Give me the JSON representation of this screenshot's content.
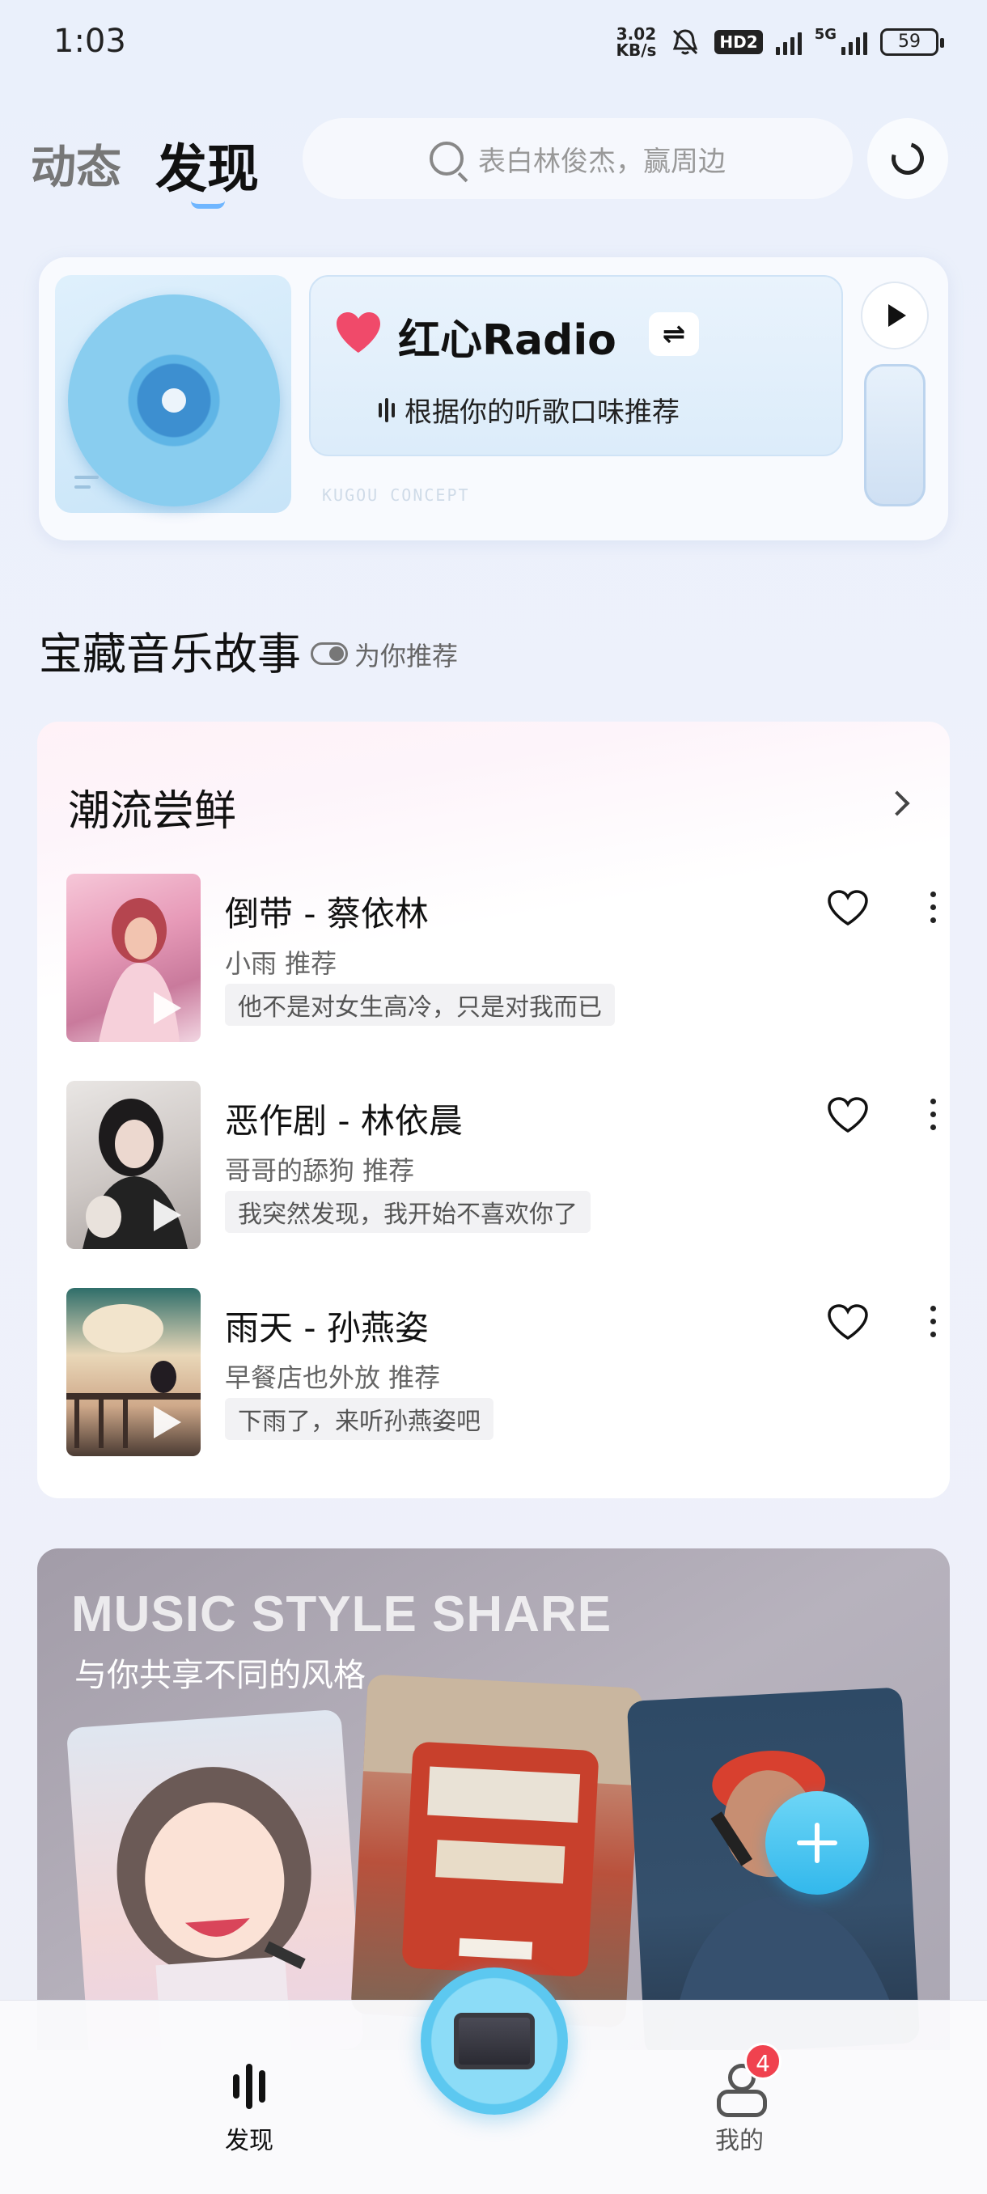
{
  "status_bar": {
    "time": "1:03",
    "net_speed_value": "3.02",
    "net_speed_unit": "KB/s",
    "hd_label": "HD2",
    "signal_label": "5G",
    "battery": "59"
  },
  "top_nav": {
    "tab_dongtai": "动态",
    "tab_faxian": "发现",
    "search_placeholder": "表白林俊杰，赢周边"
  },
  "radio": {
    "title": "红心Radio",
    "switch_symbol": "⇌",
    "subtitle": "根据你的听歌口味推荐",
    "watermark": "KUGOU CONCEPT"
  },
  "treasure_section": {
    "title": "宝藏音乐故事",
    "toggle_label": "为你推荐"
  },
  "rec_card": {
    "title": "潮流尝鲜",
    "songs": [
      {
        "title": "倒带 - 蔡依林",
        "recommender": "小雨 推荐",
        "tag": "他不是对女生高冷，只是对我而已"
      },
      {
        "title": "恶作剧 - 林依晨",
        "recommender": "哥哥的舔狗 推荐",
        "tag": "我突然发现，我开始不喜欢你了"
      },
      {
        "title": "雨天 - 孙燕姿",
        "recommender": "早餐店也外放 推荐",
        "tag": "下雨了，来听孙燕姿吧"
      }
    ]
  },
  "style_share": {
    "heading": "MUSIC STYLE SHARE",
    "subtitle": "与你共享不同的风格"
  },
  "bottom_nav": {
    "faxian_label": "发现",
    "wode_label": "我的",
    "wode_badge": "4"
  },
  "colors": {
    "accent_blue": "#32b8ec",
    "heart_pink": "#f04a6a",
    "badge_red": "#f0424f"
  },
  "icons": [
    "search-icon",
    "assistant-icon",
    "heart-icon",
    "switch-icon",
    "voice-icon",
    "play-icon",
    "chevron-right-icon",
    "like-heart-icon",
    "more-icon",
    "plus-icon",
    "bars-icon",
    "user-icon"
  ]
}
